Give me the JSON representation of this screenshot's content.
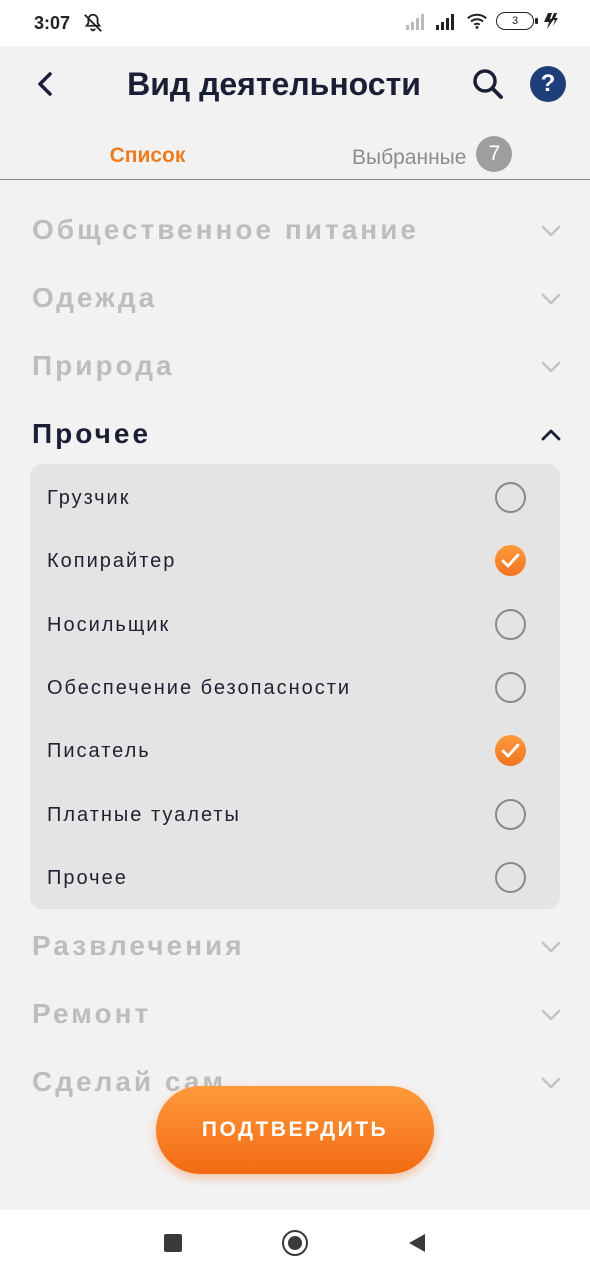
{
  "status_bar": {
    "time": "3:07",
    "battery": "3",
    "icons": [
      "bell-off-icon",
      "signal-icon",
      "signal-icon",
      "wifi-icon",
      "battery-icon",
      "charging-icon"
    ]
  },
  "header": {
    "title": "Вид деятельности",
    "back_icon": "chevron-left-icon",
    "search_icon": "search-icon",
    "help_label": "?"
  },
  "tabs": {
    "list_label": "Список",
    "selected_label": "Выбранные",
    "selected_count": "7",
    "active": "list"
  },
  "categories": [
    {
      "label": "Общественное питание",
      "expanded": false
    },
    {
      "label": "Одежда",
      "expanded": false
    },
    {
      "label": "Природа",
      "expanded": false
    },
    {
      "label": "Прочее",
      "expanded": true
    },
    {
      "label": "Развлечения",
      "expanded": false
    },
    {
      "label": "Ремонт",
      "expanded": false
    },
    {
      "label": "Сделай сам",
      "expanded": false
    }
  ],
  "subitems": [
    {
      "label": "Грузчик",
      "checked": false
    },
    {
      "label": "Копирайтер",
      "checked": true
    },
    {
      "label": "Носильщик",
      "checked": false
    },
    {
      "label": "Обеспечение безопасности",
      "checked": false
    },
    {
      "label": "Писатель",
      "checked": true
    },
    {
      "label": "Платные туалеты",
      "checked": false
    },
    {
      "label": "Прочее",
      "checked": false
    }
  ],
  "confirm_button": {
    "label": "ПОДТВЕРДИТЬ"
  },
  "colors": {
    "accent": "#f07b1f",
    "title": "#1a1f36",
    "inactive_category": "#bdbdbd",
    "help_bg": "#1f3f7a"
  },
  "nav_bar": {
    "icons": [
      "recents-icon",
      "home-icon",
      "back-icon"
    ]
  }
}
